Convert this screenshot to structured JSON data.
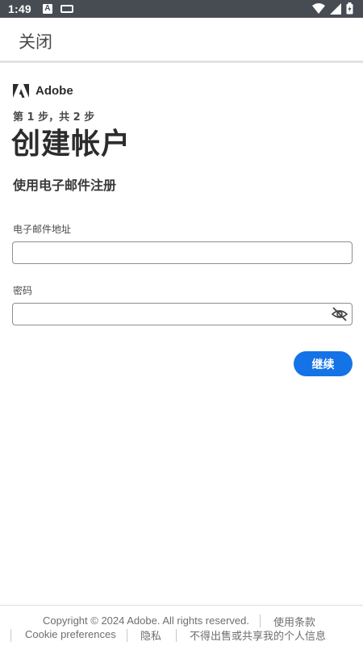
{
  "status_bar": {
    "time": "1:49",
    "a_icon": "A"
  },
  "header": {
    "close_label": "关闭"
  },
  "brand": {
    "name": "Adobe"
  },
  "form": {
    "step_text": "第 1 步，共 2 步",
    "title": "创建帐户",
    "subtitle": "使用电子邮件注册",
    "email_label": "电子邮件地址",
    "email_value": "",
    "password_label": "密码",
    "password_value": "",
    "continue_label": "继续"
  },
  "footer": {
    "copyright": "Copyright © 2024 Adobe. All rights reserved.",
    "terms": "使用条款",
    "cookie": "Cookie preferences",
    "privacy": "隐私",
    "do_not_sell": "不得出售或共享我的个人信息"
  },
  "colors": {
    "accent": "#1473e6",
    "status_bar": "#474b52"
  }
}
